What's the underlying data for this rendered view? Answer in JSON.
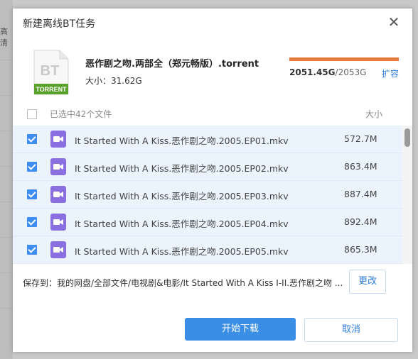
{
  "background": {
    "side_text": "高清"
  },
  "dialog": {
    "title": "新建离线BT任务",
    "close_glyph": "✕"
  },
  "torrent": {
    "icon_text_top": "BT",
    "icon_text_bottom": "TORRENT",
    "name": "恶作剧之吻.两部全（郑元畅版）.torrent",
    "size_label": "大小：",
    "size": "31.62G"
  },
  "quota": {
    "used": "2051.45G",
    "separator": "/",
    "total": "2053G",
    "used_fraction": 0.999,
    "fill_color": "#e87a3b",
    "expand_label": "扩容"
  },
  "list": {
    "selected_text": "已选中42个文件",
    "size_header": "大小",
    "files": [
      {
        "name": "It Started With A Kiss.恶作剧之吻.2005.EP01.mkv",
        "size": "572.7M",
        "checked": true
      },
      {
        "name": "It Started With A Kiss.恶作剧之吻.2005.EP02.mkv",
        "size": "863.4M",
        "checked": true
      },
      {
        "name": "It Started With A Kiss.恶作剧之吻.2005.EP03.mkv",
        "size": "887.4M",
        "checked": true
      },
      {
        "name": "It Started With A Kiss.恶作剧之吻.2005.EP04.mkv",
        "size": "892.4M",
        "checked": true
      },
      {
        "name": "It Started With A Kiss.恶作剧之吻.2005.EP05.mkv",
        "size": "865.3M",
        "checked": true
      }
    ]
  },
  "save": {
    "path_text": "保存到：我的网盘/全部文件/电视剧&电影/It Started With A Kiss I-II.恶作剧之吻 ...",
    "change_label": "更改"
  },
  "buttons": {
    "start_label": "开始下载",
    "cancel_label": "取消"
  },
  "colors": {
    "accent": "#3a8ee6",
    "link": "#2f7ed8",
    "video_icon": "#8a6fe0",
    "bt_icon_green": "#5aa02c"
  }
}
